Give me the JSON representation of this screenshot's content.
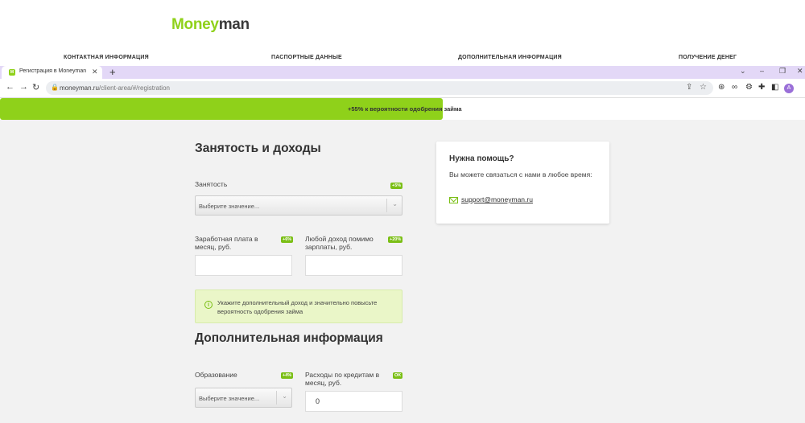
{
  "site": {
    "logo_green": "Money",
    "logo_dark": "man",
    "steps": [
      "КОНТАКТНАЯ ИНФОРМАЦИЯ",
      "ПАСПОРТНЫЕ ДАННЫЕ",
      "ДОПОЛНИТЕЛЬНАЯ ИНФОРМАЦИЯ",
      "ПОЛУЧЕНИЕ ДЕНЕГ"
    ]
  },
  "browser": {
    "tab_title": "Регистрация в Moneyman",
    "tab_favicon": "M",
    "url_domain": "moneyman.ru",
    "url_path": "/client-area/#/registration",
    "profile_initial": "A"
  },
  "progress": {
    "text": "+55% к вероятности одобрения займа",
    "fill_fraction": 0.55,
    "color": "#8fd11a"
  },
  "employment": {
    "title": "Занятость и доходы",
    "occupation_label": "Занятость",
    "occupation_badge": "+5%",
    "occupation_placeholder": "Выберите значение...",
    "salary_label": "Заработная плата в месяц, руб.",
    "salary_badge": "+6%",
    "other_income_label": "Любой доход помимо зарплаты, руб.",
    "other_income_badge": "+20%",
    "hint": "Укажите дополнительный доход и значительно повысьте вероятность одобрения займа"
  },
  "additional": {
    "title": "Дополнительная информация",
    "education_label": "Образование",
    "education_badge": "+4%",
    "education_placeholder": "Выберите значение...",
    "credit_label": "Расходы по кредитам в месяц, руб.",
    "credit_badge": "OK",
    "credit_value": "0"
  },
  "help": {
    "title": "Нужна помощь?",
    "text": "Вы можете связаться с нами в любое время:",
    "email": "support@moneyman.ru"
  },
  "icons": [
    "tab-close-icon",
    "new-tab-icon",
    "back-icon",
    "forward-icon",
    "reload-icon",
    "lock-icon",
    "share-icon",
    "star-icon",
    "extension-icon",
    "minimize-icon",
    "restore-icon",
    "close-window-icon",
    "info-icon",
    "mail-icon",
    "chevron-down-icon"
  ]
}
